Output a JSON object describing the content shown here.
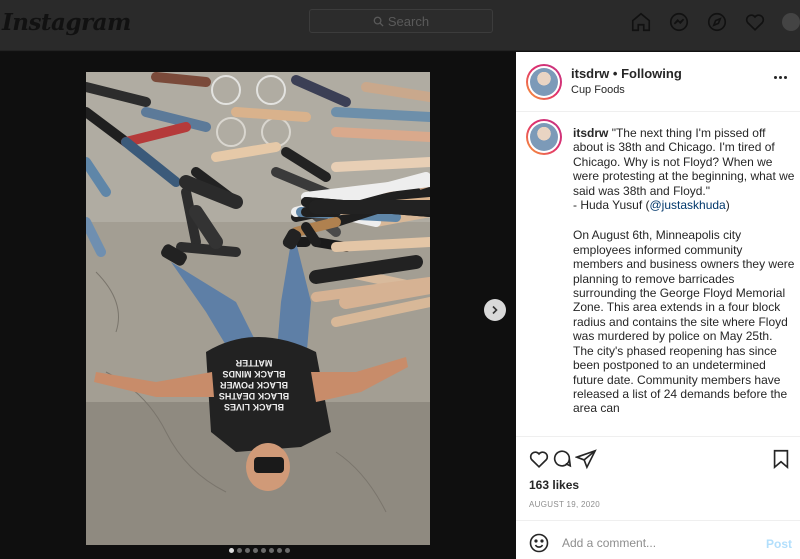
{
  "nav": {
    "logo": "Instagram",
    "search_placeholder": "Search",
    "icons": [
      "home-icon",
      "messenger-icon",
      "explore-icon",
      "heart-icon",
      "avatar"
    ]
  },
  "post": {
    "username": "itsdrw",
    "separator": "•",
    "follow_status": "Following",
    "location": "Cup Foods",
    "caption": {
      "username": "itsdrw",
      "quote": "\"The next thing I'm pissed off about is 38th and Chicago. I'm tired of Chicago. Why is not Floyd? When we were protesting at the beginning, what we said was 38th and Floyd.\"",
      "attribution_prefix": "- Huda Yusuf (",
      "mention": "@justaskhuda",
      "attribution_suffix": ")",
      "body": "On August 6th, Minneapolis city employees informed community members and business owners they were planning to remove barricades surrounding the George Floyd Memorial Zone. This area extends in a four block radius and contains the site where Floyd was murdered by police on May 25th.  The city's phased reopening has since been postponed to an undetermined future date. Community members have released a list of 24 demands before the area can"
    },
    "likes": "163 likes",
    "date": "AUGUST 19, 2020",
    "comment_placeholder": "Add a comment...",
    "post_label": "Post",
    "carousel_count": 8,
    "carousel_active": 0,
    "photo_shirt_text": [
      "BLACK LIVES",
      "BLACK DEATHS",
      "BLACK POWER",
      "BLACK MINDS",
      "MATTER"
    ]
  },
  "colors": {
    "link": "#00376b",
    "post_button": "#b2dffc",
    "muted": "#8e8e8e"
  }
}
